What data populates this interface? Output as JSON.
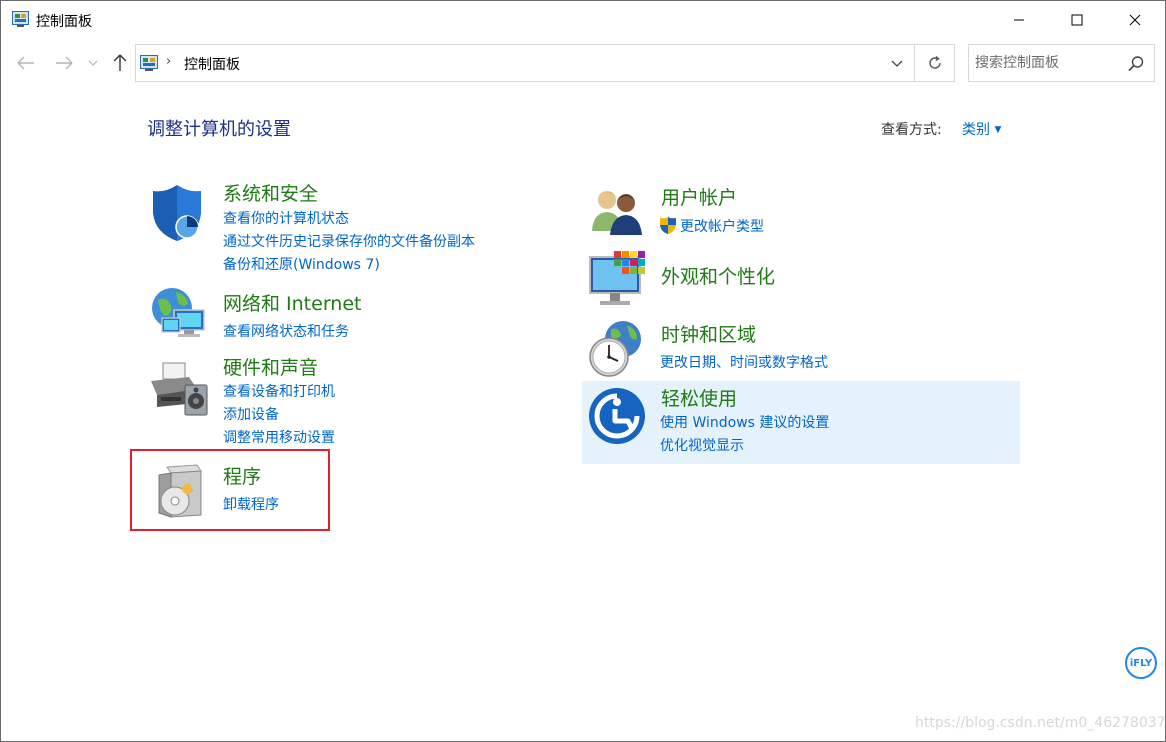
{
  "window": {
    "title": "控制面板",
    "controls": {
      "minimize": "minimize-icon",
      "maximize": "maximize-icon",
      "close": "close-icon"
    }
  },
  "address": {
    "path": "控制面板",
    "search_placeholder": "搜索控制面板"
  },
  "main": {
    "heading": "调整计算机的设置",
    "view_by_label": "查看方式:",
    "view_by_value": "类别"
  },
  "categories_left": [
    {
      "title": "系统和安全",
      "icon": "shield-icon",
      "links": [
        "查看你的计算机状态",
        "通过文件历史记录保存你的文件备份副本",
        "备份和还原(Windows 7)"
      ]
    },
    {
      "title": "网络和 Internet",
      "icon": "network-globe-icon",
      "links": [
        "查看网络状态和任务"
      ]
    },
    {
      "title": "硬件和声音",
      "icon": "printer-speaker-icon",
      "links": [
        "查看设备和打印机",
        "添加设备",
        "调整常用移动设置"
      ]
    },
    {
      "title": "程序",
      "icon": "programs-disc-icon",
      "links": [
        "卸载程序"
      ]
    }
  ],
  "categories_right": [
    {
      "title": "用户帐户",
      "icon": "users-icon",
      "links": [
        "更改帐户类型"
      ]
    },
    {
      "title": "外观和个性化",
      "icon": "monitor-palette-icon",
      "links": []
    },
    {
      "title": "时钟和区域",
      "icon": "clock-globe-icon",
      "links": [
        "更改日期、时间或数字格式"
      ]
    },
    {
      "title": "轻松使用",
      "icon": "ease-of-access-icon",
      "links": [
        "使用 Windows 建议的设置",
        "优化视觉显示"
      ]
    }
  ],
  "overlay": {
    "ifly_badge": "iFLY",
    "watermark": "https://blog.csdn.net/m0_46278037"
  },
  "colors": {
    "category_title": "#1e7b16",
    "link": "#0066cc",
    "heading": "#1e3287",
    "hover": "#e5f1fb",
    "highlight_box": "#e0202a"
  }
}
